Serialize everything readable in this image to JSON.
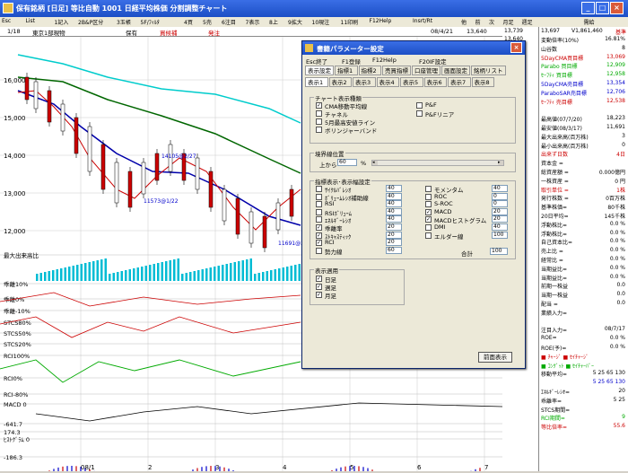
{
  "window": {
    "title": "保有銘柄 [日足] 等比自動  1001 日経平均株価 分割調整チャート"
  },
  "toolbar": [
    "Esc",
    "List",
    "1記入",
    "2B&P区分",
    "3玉帳",
    "5F/ﾌｨﾙﾀ",
    "4買",
    "5売",
    "6注目",
    "7表示",
    "8上",
    "9拡大",
    "10現注",
    "11印刷",
    "F12Help",
    "Insrt/Rt",
    "他",
    "前",
    "次",
    "月足",
    "週足",
    "",
    "",
    "",
    "需給"
  ],
  "info_bar": {
    "date": "1/18",
    "code": "東京1部現物",
    "holding": "保有",
    "buy": "買候補",
    "order": "発注",
    "date2": "08/4/21",
    "o": "13,640",
    "h": "13,739",
    "l": "13,640",
    "c": "13,697",
    "vol": "V1,861,460",
    "kiju": "基準"
  },
  "chart_data": {
    "type": "line",
    "title": "日経平均株価",
    "price_axis": {
      "ticks": [
        "16,000",
        "15,000",
        "14,000",
        "13,000",
        "12,000"
      ]
    },
    "x_labels": [
      "08/1",
      "2",
      "3",
      "4",
      "5",
      "6",
      "7"
    ],
    "annotations": [
      "14105@2/27",
      "11573@1/22",
      "11691@3/17"
    ],
    "panels": [
      "最大出来高比",
      "乖離10%",
      "乖離0%",
      "乖離-10%",
      "STCS80%",
      "STCS50%",
      "STCS20%",
      "RCI100%",
      "RCI0%",
      "RCI-80%",
      "MACD 0",
      "-641.7",
      "174.3",
      "ﾋｽﾄｸﾞﾗﾑ 0",
      "-186.3"
    ]
  },
  "right_panel": {
    "rows": [
      {
        "l": "変動倍率(10%)",
        "v": "16.81%",
        "c": "#000"
      },
      {
        "l": "山谷数",
        "v": "8",
        "c": "#000"
      },
      {
        "l": "5DayCMA買目標",
        "v": "13,069",
        "c": "#c00"
      },
      {
        "l": "Parabo 買目標",
        "v": "12,909",
        "c": "#0a0"
      },
      {
        "l": "ｾｰﾌﾃｨ 買目標",
        "v": "12,958",
        "c": "#0a0"
      },
      {
        "l": "5DayCMA売目標",
        "v": "13,354",
        "c": "#00c"
      },
      {
        "l": "ParaboSAR売目標",
        "v": "12,706",
        "c": "#00c"
      },
      {
        "l": "ｾｰﾌﾃｨ 売目標",
        "v": "12,538",
        "c": "#c00"
      },
      {
        "l": "",
        "v": "",
        "c": "#000"
      },
      {
        "l": "最高値(07/7/20)",
        "v": "18,223",
        "c": "#000"
      },
      {
        "l": "最安値(08/3/17)",
        "v": "11,691",
        "c": "#000"
      },
      {
        "l": "最大出来高(百万株)",
        "v": "3",
        "c": "#000"
      },
      {
        "l": "最小出来高(百万株)",
        "v": "0",
        "c": "#000"
      },
      {
        "l": "出来ず日数",
        "v": "4日",
        "c": "#c00"
      },
      {
        "l": "資本金 =",
        "v": "",
        "c": "#000"
      },
      {
        "l": "総資産額 =",
        "v": "0.000億円",
        "c": "#000"
      },
      {
        "l": "一株資産 =",
        "v": "0 円",
        "c": "#000"
      },
      {
        "l": "取引単位 =",
        "v": "1株",
        "c": "#c00"
      },
      {
        "l": "発行株数 =",
        "v": "0百万株",
        "c": "#000"
      },
      {
        "l": "基準株価=",
        "v": "80千株",
        "c": "#000"
      },
      {
        "l": "20日平均=",
        "v": "145千株",
        "c": "#000"
      },
      {
        "l": "浮動株比=",
        "v": "0.0 %",
        "c": "#000"
      },
      {
        "l": "浮動株比=",
        "v": "0.0 %",
        "c": "#000"
      },
      {
        "l": "自己資本比=",
        "v": "0.0 %",
        "c": "#000"
      },
      {
        "l": "売上比 =",
        "v": "0.0 %",
        "c": "#000"
      },
      {
        "l": "経常比 =",
        "v": "0.0 %",
        "c": "#000"
      },
      {
        "l": "当期益比=",
        "v": "0.0 %",
        "c": "#000"
      },
      {
        "l": "当期益比=",
        "v": "0.0 %",
        "c": "#000"
      },
      {
        "l": "前期一株益",
        "v": "0.0",
        "c": "#000"
      },
      {
        "l": "当期一株益",
        "v": "0.0",
        "c": "#000"
      },
      {
        "l": "配当 =",
        "v": "0.0",
        "c": "#000"
      },
      {
        "l": "業績入力=",
        "v": "",
        "c": "#000"
      },
      {
        "l": "",
        "v": "",
        "c": "#000"
      },
      {
        "l": "注目入力=",
        "v": "08/7/17",
        "c": "#000"
      },
      {
        "l": "ROE=",
        "v": "0.0 %",
        "c": "#000"
      },
      {
        "l": "ROE(予)=",
        "v": "0.0 %",
        "c": "#000"
      },
      {
        "l": "■ ﾁｬｰｼﾞ ■ ｾｲﾁｬｰｼﾞ",
        "v": "",
        "c": "#c00"
      },
      {
        "l": "■ ｺﾝｸﾞｯﾄ ■ ｾｲﾁｬｰﾊﾞｰ",
        "v": "",
        "c": "#0a0"
      },
      {
        "l": "移動平均=",
        "v": "5 25 65 130",
        "c": "#000"
      },
      {
        "l": "",
        "v": "5 25 65 130",
        "c": "#00c"
      },
      {
        "l": "ｴﾈﾙｷﾞｰﾚｼｵ=",
        "v": "20",
        "c": "#000"
      },
      {
        "l": "乖離率=",
        "v": "5 25",
        "c": "#000"
      },
      {
        "l": "STCS期間=",
        "v": "",
        "c": "#000"
      },
      {
        "l": "RCI期間=",
        "v": "9",
        "c": "#0a0"
      },
      {
        "l": "等比倍率=",
        "v": "55.6",
        "c": "#c00"
      }
    ]
  },
  "dialog": {
    "title": "書籍パラメーター設定",
    "menu": [
      "Esc終了",
      "F1登録",
      "F12Help",
      "F20IF設定"
    ],
    "tabs1": [
      "表示設定",
      "指標1",
      "指標2",
      "売買指標",
      "口座管理",
      "画面設定",
      "銘柄リスト"
    ],
    "tabs2": [
      "表示1",
      "表示2",
      "表示3",
      "表示4",
      "表示5",
      "表示6",
      "表示7",
      "表示8"
    ],
    "chart_group": {
      "title": "チャート表示種類",
      "items": [
        {
          "l": "CMA移動平均線",
          "c": true
        },
        {
          "l": "P&F",
          "c": false
        },
        {
          "l": "チャネル",
          "c": false
        },
        {
          "l": "P&Fリニア",
          "c": false
        },
        {
          "l": "5月最高安値ライン",
          "c": false
        },
        {
          "l": "ボリンジャーバンド",
          "c": false
        }
      ]
    },
    "border": {
      "title": "境界線位置",
      "label": "上から",
      "value": "60",
      "unit": "%"
    },
    "ind_group": {
      "title": "指標表示･表示幅設定",
      "left": [
        {
          "l": "ｻｲｸﾙﾊﾞﾚｼｵ",
          "c": false,
          "v": "40"
        },
        {
          "l": "ﾎﾞﾘｭｰﾑﾚｼｵ補助線",
          "c": false,
          "v": "40"
        },
        {
          "l": "RSI",
          "c": false,
          "v": "40"
        },
        {
          "l": "RSIﾎﾞﾘｭｰﾑ",
          "c": false,
          "v": "40"
        },
        {
          "l": "ｴﾈﾙｷﾞｰﾚｼｵ",
          "c": false,
          "v": "40"
        },
        {
          "l": "乖離率",
          "c": true,
          "v": "20"
        },
        {
          "l": "ｽﾄｷｬｽﾃｨｯｸ",
          "c": true,
          "v": "20"
        },
        {
          "l": "RCI",
          "c": true,
          "v": "20"
        },
        {
          "l": "勢力線",
          "c": false,
          "v": "60"
        }
      ],
      "right": [
        {
          "l": "モメンタム",
          "c": false,
          "v": "40"
        },
        {
          "l": "ROC",
          "c": false,
          "v": "0"
        },
        {
          "l": "S-ROC",
          "c": false,
          "v": "0"
        },
        {
          "l": "MACD",
          "c": true,
          "v": "20"
        },
        {
          "l": "MACDヒストグラム",
          "c": true,
          "v": "20"
        },
        {
          "l": "DMI",
          "c": false,
          "v": "40"
        },
        {
          "l": "エルダー線",
          "c": false,
          "v": "100"
        }
      ],
      "total_label": "合計",
      "total": "100"
    },
    "disp_group": {
      "title": "表示週用",
      "items": [
        {
          "l": "日足",
          "c": true
        },
        {
          "l": "週足",
          "c": true
        },
        {
          "l": "月足",
          "c": true
        }
      ]
    },
    "prev_btn": "前面表示"
  }
}
